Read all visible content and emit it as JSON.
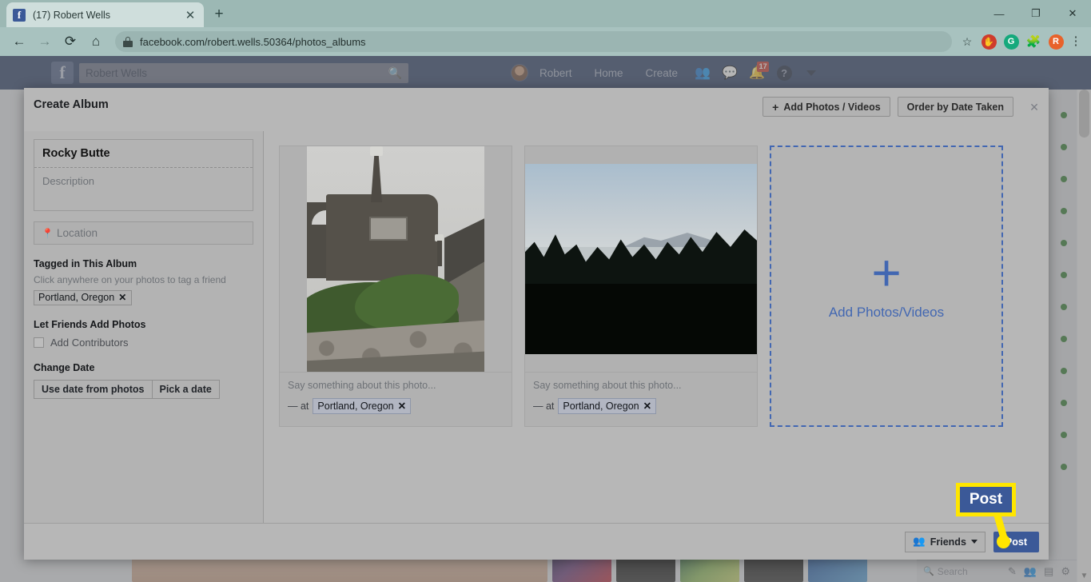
{
  "browser": {
    "tab": {
      "title": "(17) Robert Wells",
      "favicon": "facebook-icon",
      "close_label": "✕"
    },
    "new_tab_label": "+",
    "window_controls": {
      "minimize": "—",
      "maximize": "❐",
      "close": "✕"
    },
    "nav": {
      "back": "←",
      "forward": "→",
      "reload": "⟳",
      "home": "⌂"
    },
    "url": "facebook.com/robert.wells.50364/photos_albums",
    "bookmark_star": "☆",
    "extensions": [
      {
        "name": "adblock-extension-icon",
        "glyph": "✋",
        "color": "#cf3b2c"
      },
      {
        "name": "grammarly-extension-icon",
        "glyph": "G",
        "color": "#15a97c"
      },
      {
        "name": "puzzle-extensions-icon",
        "glyph": "🧩",
        "color": "#2b2b2b"
      },
      {
        "name": "profile-avatar-icon",
        "glyph": "R",
        "color": "#e8622a"
      }
    ],
    "menu_label": "⋮"
  },
  "facebook_header": {
    "logo": "f",
    "search_value": "Robert Wells",
    "search_icon": "search-icon",
    "profile_name": "Robert",
    "links": [
      "Home",
      "Create"
    ],
    "icons": [
      {
        "name": "friend-requests-icon",
        "glyph": "👥",
        "badge": ""
      },
      {
        "name": "messenger-icon",
        "glyph": "💬",
        "badge": ""
      },
      {
        "name": "notifications-icon",
        "glyph": "🔔",
        "badge": "17"
      },
      {
        "name": "help-icon",
        "glyph": "?",
        "badge": ""
      }
    ],
    "account_caret": "▾"
  },
  "chat_sidebar": {
    "search_placeholder": "Search",
    "search_icon": "search-icon",
    "icons": [
      "compose-icon",
      "new-group-icon",
      "new-room-icon",
      "settings-gear-icon"
    ],
    "online_dot_count": 12,
    "online_dot_color": "#2d7a2d"
  },
  "modal": {
    "title": "Create Album",
    "close_label": "✕",
    "header_buttons": [
      {
        "name": "add-photos-videos-button",
        "plus": "+",
        "label": "Add Photos / Videos"
      },
      {
        "name": "order-by-date-taken-button",
        "label": "Order by Date Taken"
      }
    ],
    "sidebar": {
      "album_name": "Rocky Butte",
      "description_placeholder": "Description",
      "location_placeholder": "Location",
      "location_icon": "map-pin-icon",
      "tagged_heading": "Tagged in This Album",
      "tagged_hint": "Click anywhere on your photos to tag a friend",
      "tagged_chip": {
        "label": "Portland, Oregon",
        "remove": "✕"
      },
      "contributors_heading": "Let Friends Add Photos",
      "contributors_checkbox_label": "Add Contributors",
      "contributors_checked": false,
      "change_date_heading": "Change Date",
      "date_buttons": [
        "Use date from photos",
        "Pick a date"
      ]
    },
    "photos": [
      {
        "name": "photo-card-rocky-butte-wall",
        "alt": "Stone fort wall with lantern spire at Rocky Butte",
        "caption_placeholder": "Say something about this photo...",
        "at_prefix": "— at",
        "place_chip": {
          "label": "Portland, Oregon",
          "remove": "✕"
        }
      },
      {
        "name": "photo-card-rocky-butte-view",
        "alt": "Evergreen treetops with hazy mountain view",
        "caption_placeholder": "Say something about this photo...",
        "at_prefix": "— at",
        "place_chip": {
          "label": "Portland, Oregon",
          "remove": "✕"
        }
      }
    ],
    "dropzone": {
      "plus": "+",
      "label": "Add Photos/Videos"
    },
    "footer": {
      "privacy_label": "Friends",
      "privacy_icon": "friends-icon",
      "privacy_caret": "▾",
      "post_label": "Post"
    }
  },
  "callout": {
    "label": "Post",
    "outline_color": "#ffe600",
    "fill_color": "#3b5998"
  }
}
